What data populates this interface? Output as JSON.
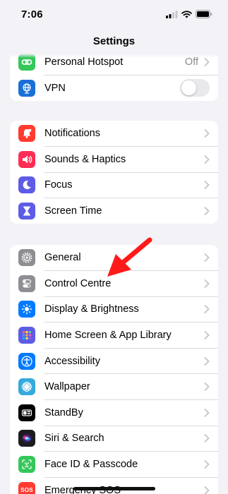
{
  "status_bar": {
    "time": "7:06"
  },
  "nav": {
    "title": "Settings"
  },
  "groups": [
    {
      "rows": [
        {
          "label": "Personal Hotspot",
          "value": "Off",
          "icon": "link-icon",
          "color": "#34c759"
        },
        {
          "label": "VPN",
          "toggle": false,
          "icon": "globe-icon",
          "color": "#1a6fd8"
        }
      ]
    },
    {
      "rows": [
        {
          "label": "Notifications",
          "icon": "bell-icon",
          "color": "#ff3b30"
        },
        {
          "label": "Sounds & Haptics",
          "icon": "speaker-icon",
          "color": "#ff2d55"
        },
        {
          "label": "Focus",
          "icon": "moon-icon",
          "color": "#5e5ce6"
        },
        {
          "label": "Screen Time",
          "icon": "hourglass-icon",
          "color": "#5e5ce6"
        }
      ]
    },
    {
      "rows": [
        {
          "label": "General",
          "icon": "gear-icon",
          "color": "#8e8e93"
        },
        {
          "label": "Control Centre",
          "icon": "switches-icon",
          "color": "#8e8e93"
        },
        {
          "label": "Display & Brightness",
          "icon": "sun-icon",
          "color": "#007aff"
        },
        {
          "label": "Home Screen & App Library",
          "icon": "app-grid-icon",
          "color": "#5e5ce6"
        },
        {
          "label": "Accessibility",
          "icon": "accessibility-icon",
          "color": "#007aff"
        },
        {
          "label": "Wallpaper",
          "icon": "flower-icon",
          "color": "#35aadc"
        },
        {
          "label": "StandBy",
          "icon": "standby-icon",
          "color": "#000000"
        },
        {
          "label": "Siri & Search",
          "icon": "siri-icon",
          "color": "#1c1c1e"
        },
        {
          "label": "Face ID & Passcode",
          "icon": "face-id-icon",
          "color": "#34c759"
        },
        {
          "label": "Emergency SOS",
          "icon": "sos-icon",
          "color": "#ff3b30",
          "badge": "SOS"
        }
      ]
    }
  ],
  "annotation": {
    "color": "#ff1a1a"
  }
}
